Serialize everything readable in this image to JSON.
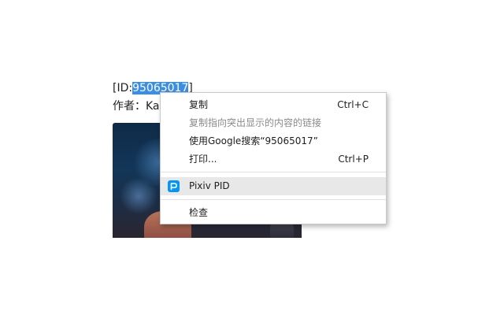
{
  "page": {
    "id_prefix": "[ID:",
    "id_value": "95065017",
    "id_suffix": "]",
    "author_line": "作者：Ka"
  },
  "context_menu": {
    "copy": {
      "label": "复制",
      "shortcut": "Ctrl+C"
    },
    "copy_link_highlight": {
      "label": "复制指向突出显示的内容的链接"
    },
    "search_google": {
      "label": "使用Google搜索“95065017”"
    },
    "print": {
      "label": "打印...",
      "shortcut": "Ctrl+P"
    },
    "pixiv_pid": {
      "label": "Pixiv PID",
      "icon": "pixiv-icon"
    },
    "inspect": {
      "label": "检查"
    }
  },
  "colors": {
    "selection": "#3a8ee6",
    "menu_highlight": "#e8e8e8",
    "pixiv_brand": "#0096fa"
  }
}
